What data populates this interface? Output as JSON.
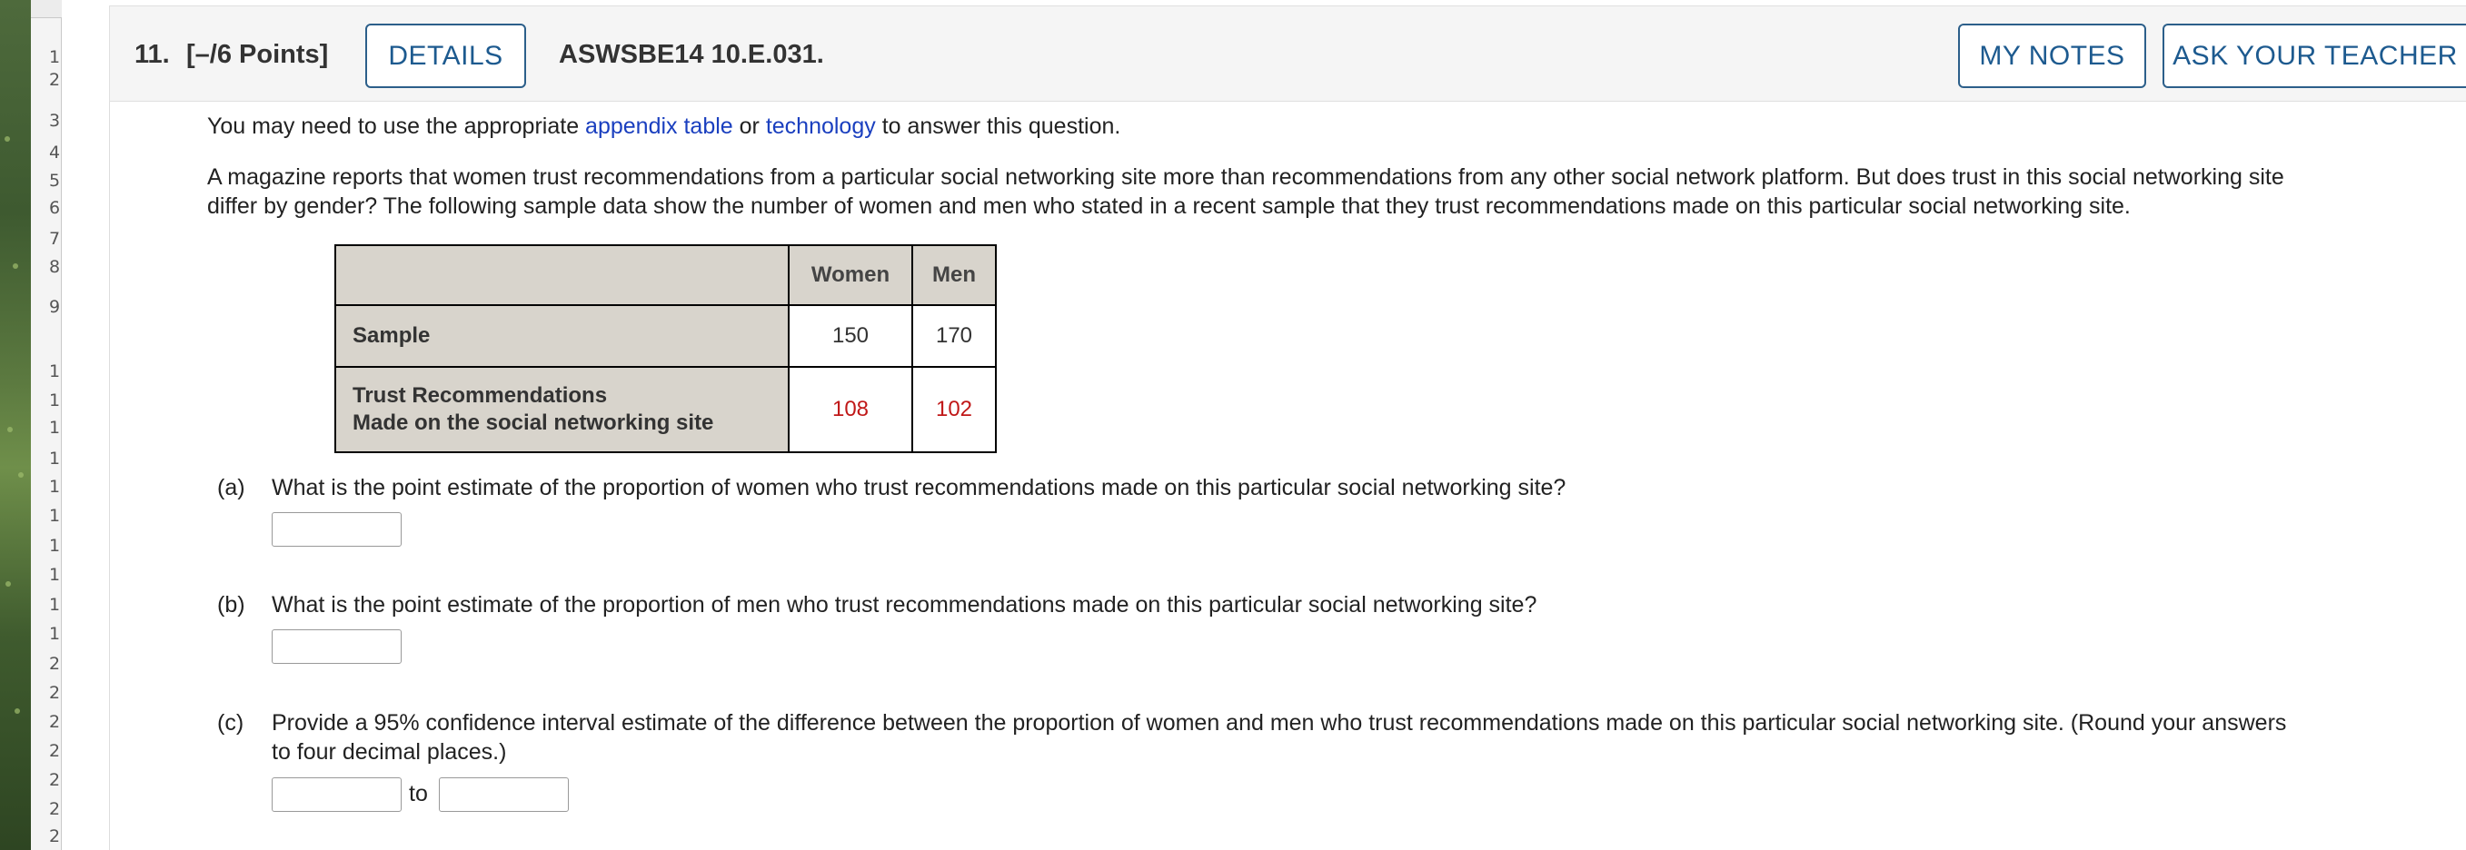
{
  "gutter": {
    "row_numbers": [
      "1",
      "2",
      "3",
      "4",
      "5",
      "6",
      "7",
      "8",
      "9",
      "1",
      "1",
      "1",
      "1",
      "1",
      "1",
      "1",
      "1",
      "1",
      "1",
      "2",
      "2",
      "2",
      "2",
      "2",
      "2",
      "2"
    ]
  },
  "header": {
    "question_number": "11.",
    "points": "[–/6 Points]",
    "details_label": "DETAILS",
    "problem_code": "ASWSBE14 10.E.031.",
    "my_notes_label": "MY NOTES",
    "ask_teacher_label": "ASK YOUR TEACHER"
  },
  "intro": {
    "prefix": "You may need to use the appropriate ",
    "link1": "appendix table",
    "middle": " or ",
    "link2": "technology",
    "suffix": " to answer this question."
  },
  "problem": {
    "line1": "A magazine reports that women trust recommendations from a particular social networking site more than recommendations from any other social network platform. But does trust in this social networking site",
    "line2": "differ by gender? The following sample data show the number of women and men who stated in a recent sample that they trust recommendations made on this particular social networking site."
  },
  "table": {
    "col_women": "Women",
    "col_men": "Men",
    "row1_label": "Sample",
    "row1_women": "150",
    "row1_men": "170",
    "row2_label_line1": "Trust Recommendations",
    "row2_label_line2": "Made on the social networking site",
    "row2_women": "108",
    "row2_men": "102"
  },
  "parts": {
    "a_label": "(a)",
    "a_text": "What is the point estimate of the proportion of women who trust recommendations made on this particular social networking site?",
    "b_label": "(b)",
    "b_text": "What is the point estimate of the proportion of men who trust recommendations made on this particular social networking site?",
    "c_label": "(c)",
    "c_text_line1": "Provide a 95% confidence interval estimate of the difference between the proportion of women and men who trust recommendations made on this particular social networking site. (Round your answers",
    "c_text_line2": "to four decimal places.)",
    "to_label": "to"
  },
  "colors": {
    "link": "#1a3fbf",
    "button_text": "#1d5a8f",
    "highlight_value": "#c01818",
    "table_header_bg": "#d8d4cc"
  }
}
